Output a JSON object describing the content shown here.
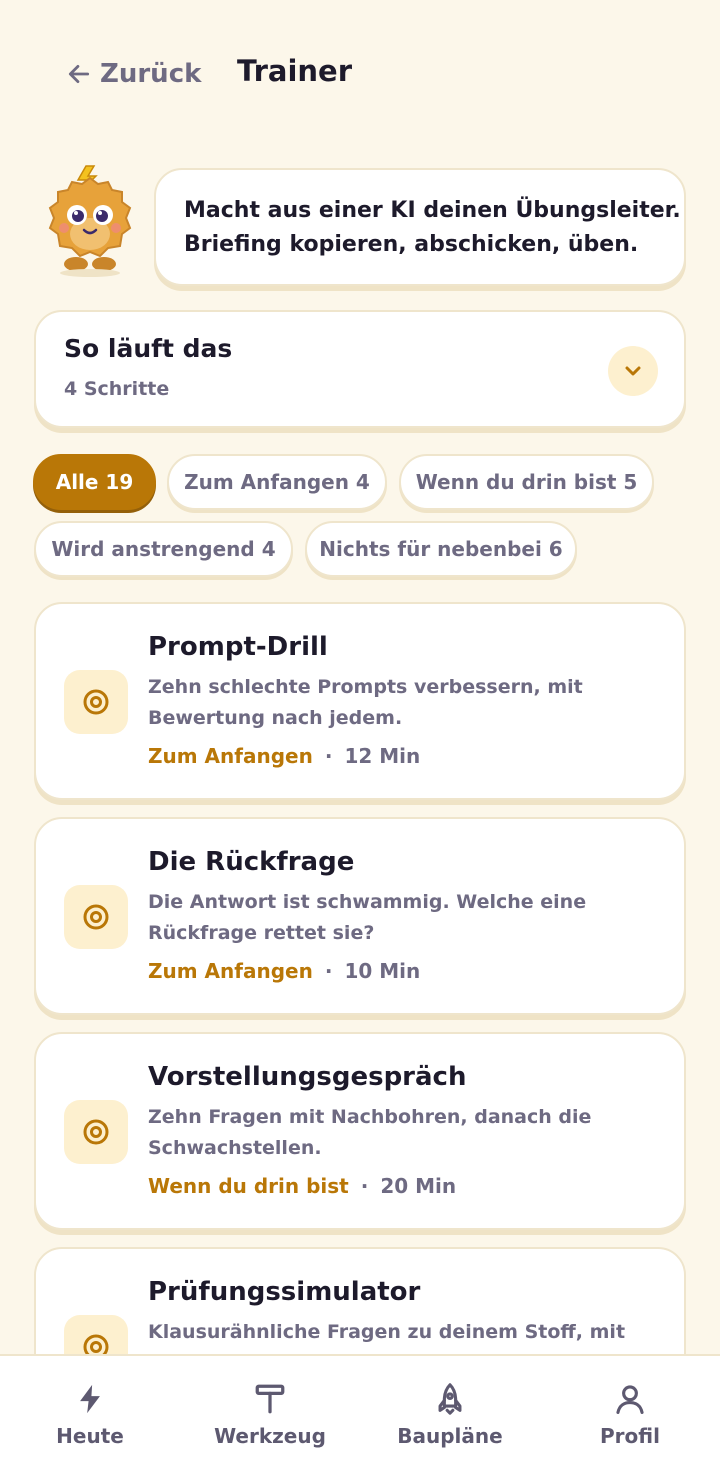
{
  "header": {
    "back_label": "Zurück",
    "title": "Trainer"
  },
  "mascot": {
    "icon": "hedgehog-mascot-icon",
    "bubble_line1": "Macht aus einer KI deinen Übungsleiter.",
    "bubble_line2": "Briefing kopieren, abschicken, üben."
  },
  "steps": {
    "title": "So läuft das",
    "subtitle": "4 Schritte",
    "icon": "chevron-down-icon"
  },
  "filters": [
    {
      "label": "Alle 19",
      "active": true
    },
    {
      "label": "Zum Anfangen 4",
      "active": false
    },
    {
      "label": "Wenn du drin bist 5",
      "active": false
    },
    {
      "label": "Wird anstrengend 4",
      "active": false
    },
    {
      "label": "Nichts für nebenbei 6",
      "active": false
    }
  ],
  "exercises": [
    {
      "title": "Prompt-Drill",
      "description": "Zehn schlechte Prompts verbessern, mit Bewertung nach jedem.",
      "level": "Zum Anfangen",
      "separator": "·",
      "duration": "12 Min",
      "icon": "target-icon"
    },
    {
      "title": "Die Rückfrage",
      "description": "Die Antwort ist schwammig. Welche eine Rückfrage rettet sie?",
      "level": "Zum Anfangen",
      "separator": "·",
      "duration": "10 Min",
      "icon": "target-icon"
    },
    {
      "title": "Vorstellungsgespräch",
      "description": "Zehn Fragen mit Nachbohren, danach die Schwachstellen.",
      "level": "Wenn du drin bist",
      "separator": "·",
      "duration": "20 Min",
      "icon": "target-icon"
    },
    {
      "title": "Prüfungssimulator",
      "description": "Klausurähnliche Fragen zu deinem Stoff, mit",
      "icon": "target-icon"
    }
  ],
  "bottom_nav": [
    {
      "label": "Heute",
      "icon": "lightning-icon"
    },
    {
      "label": "Werkzeug",
      "icon": "tool-icon"
    },
    {
      "label": "Baupläne",
      "icon": "rocket-icon"
    },
    {
      "label": "Profil",
      "icon": "person-icon"
    }
  ],
  "colors": {
    "background": "#fcf7ea",
    "accent": "#b97707",
    "accent_soft": "#fdf0cf",
    "text": "#1d1a2b",
    "muted": "#6e6a82"
  }
}
